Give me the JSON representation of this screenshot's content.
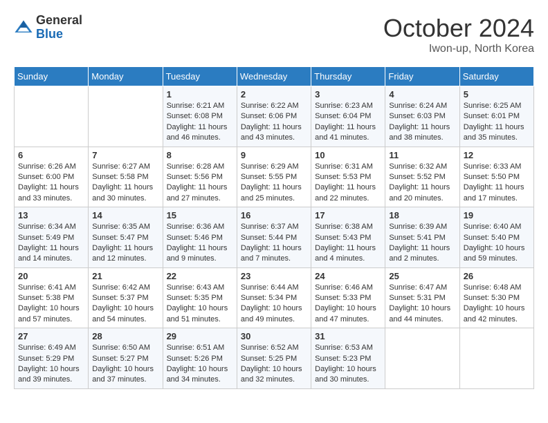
{
  "header": {
    "logo_line1": "General",
    "logo_line2": "Blue",
    "month_title": "October 2024",
    "location": "Iwon-up, North Korea"
  },
  "weekdays": [
    "Sunday",
    "Monday",
    "Tuesday",
    "Wednesday",
    "Thursday",
    "Friday",
    "Saturday"
  ],
  "weeks": [
    [
      null,
      null,
      {
        "day": 1,
        "sunrise": "6:21 AM",
        "sunset": "6:08 PM",
        "daylight": "11 hours and 46 minutes."
      },
      {
        "day": 2,
        "sunrise": "6:22 AM",
        "sunset": "6:06 PM",
        "daylight": "11 hours and 43 minutes."
      },
      {
        "day": 3,
        "sunrise": "6:23 AM",
        "sunset": "6:04 PM",
        "daylight": "11 hours and 41 minutes."
      },
      {
        "day": 4,
        "sunrise": "6:24 AM",
        "sunset": "6:03 PM",
        "daylight": "11 hours and 38 minutes."
      },
      {
        "day": 5,
        "sunrise": "6:25 AM",
        "sunset": "6:01 PM",
        "daylight": "11 hours and 35 minutes."
      }
    ],
    [
      {
        "day": 6,
        "sunrise": "6:26 AM",
        "sunset": "6:00 PM",
        "daylight": "11 hours and 33 minutes."
      },
      {
        "day": 7,
        "sunrise": "6:27 AM",
        "sunset": "5:58 PM",
        "daylight": "11 hours and 30 minutes."
      },
      {
        "day": 8,
        "sunrise": "6:28 AM",
        "sunset": "5:56 PM",
        "daylight": "11 hours and 27 minutes."
      },
      {
        "day": 9,
        "sunrise": "6:29 AM",
        "sunset": "5:55 PM",
        "daylight": "11 hours and 25 minutes."
      },
      {
        "day": 10,
        "sunrise": "6:31 AM",
        "sunset": "5:53 PM",
        "daylight": "11 hours and 22 minutes."
      },
      {
        "day": 11,
        "sunrise": "6:32 AM",
        "sunset": "5:52 PM",
        "daylight": "11 hours and 20 minutes."
      },
      {
        "day": 12,
        "sunrise": "6:33 AM",
        "sunset": "5:50 PM",
        "daylight": "11 hours and 17 minutes."
      }
    ],
    [
      {
        "day": 13,
        "sunrise": "6:34 AM",
        "sunset": "5:49 PM",
        "daylight": "11 hours and 14 minutes."
      },
      {
        "day": 14,
        "sunrise": "6:35 AM",
        "sunset": "5:47 PM",
        "daylight": "11 hours and 12 minutes."
      },
      {
        "day": 15,
        "sunrise": "6:36 AM",
        "sunset": "5:46 PM",
        "daylight": "11 hours and 9 minutes."
      },
      {
        "day": 16,
        "sunrise": "6:37 AM",
        "sunset": "5:44 PM",
        "daylight": "11 hours and 7 minutes."
      },
      {
        "day": 17,
        "sunrise": "6:38 AM",
        "sunset": "5:43 PM",
        "daylight": "11 hours and 4 minutes."
      },
      {
        "day": 18,
        "sunrise": "6:39 AM",
        "sunset": "5:41 PM",
        "daylight": "11 hours and 2 minutes."
      },
      {
        "day": 19,
        "sunrise": "6:40 AM",
        "sunset": "5:40 PM",
        "daylight": "10 hours and 59 minutes."
      }
    ],
    [
      {
        "day": 20,
        "sunrise": "6:41 AM",
        "sunset": "5:38 PM",
        "daylight": "10 hours and 57 minutes."
      },
      {
        "day": 21,
        "sunrise": "6:42 AM",
        "sunset": "5:37 PM",
        "daylight": "10 hours and 54 minutes."
      },
      {
        "day": 22,
        "sunrise": "6:43 AM",
        "sunset": "5:35 PM",
        "daylight": "10 hours and 51 minutes."
      },
      {
        "day": 23,
        "sunrise": "6:44 AM",
        "sunset": "5:34 PM",
        "daylight": "10 hours and 49 minutes."
      },
      {
        "day": 24,
        "sunrise": "6:46 AM",
        "sunset": "5:33 PM",
        "daylight": "10 hours and 47 minutes."
      },
      {
        "day": 25,
        "sunrise": "6:47 AM",
        "sunset": "5:31 PM",
        "daylight": "10 hours and 44 minutes."
      },
      {
        "day": 26,
        "sunrise": "6:48 AM",
        "sunset": "5:30 PM",
        "daylight": "10 hours and 42 minutes."
      }
    ],
    [
      {
        "day": 27,
        "sunrise": "6:49 AM",
        "sunset": "5:29 PM",
        "daylight": "10 hours and 39 minutes."
      },
      {
        "day": 28,
        "sunrise": "6:50 AM",
        "sunset": "5:27 PM",
        "daylight": "10 hours and 37 minutes."
      },
      {
        "day": 29,
        "sunrise": "6:51 AM",
        "sunset": "5:26 PM",
        "daylight": "10 hours and 34 minutes."
      },
      {
        "day": 30,
        "sunrise": "6:52 AM",
        "sunset": "5:25 PM",
        "daylight": "10 hours and 32 minutes."
      },
      {
        "day": 31,
        "sunrise": "6:53 AM",
        "sunset": "5:23 PM",
        "daylight": "10 hours and 30 minutes."
      },
      null,
      null
    ]
  ],
  "labels": {
    "sunrise": "Sunrise:",
    "sunset": "Sunset:",
    "daylight": "Daylight:"
  }
}
